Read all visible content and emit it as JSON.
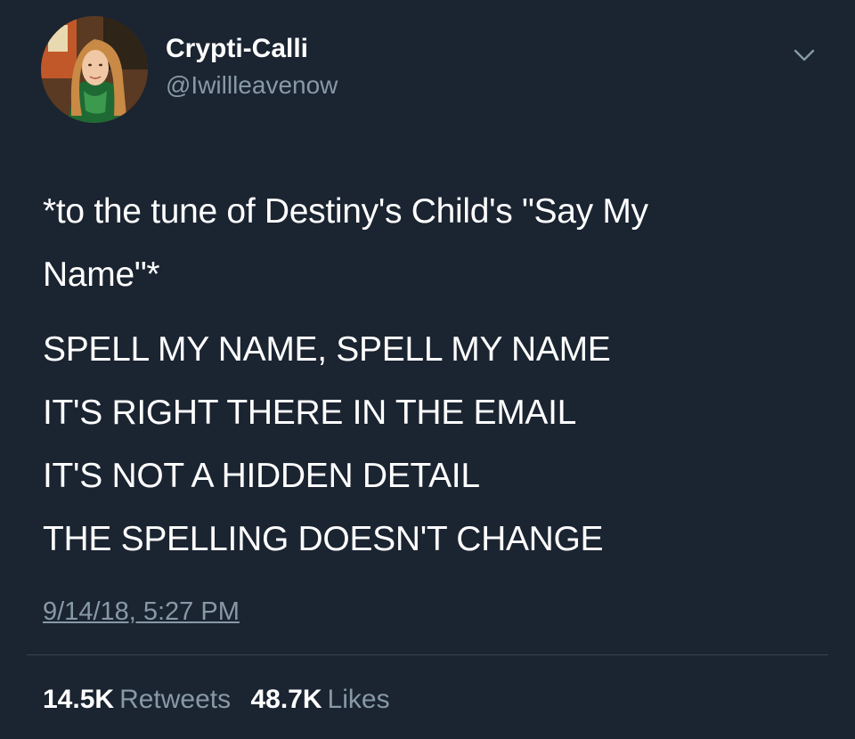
{
  "tweet": {
    "author": {
      "display_name": "Crypti-Calli",
      "handle": "@Iwillleavenow"
    },
    "lines_intro": [
      "*to the tune of Destiny's Child's \"Say My",
      "Name\"*"
    ],
    "lines_song": [
      "SPELL MY NAME, SPELL MY NAME",
      "IT'S RIGHT THERE IN THE EMAIL",
      "IT'S NOT A HIDDEN DETAIL",
      "THE SPELLING DOESN'T CHANGE"
    ],
    "timestamp": "9/14/18, 5:27 PM",
    "stats": {
      "retweets_count": "14.5K",
      "retweets_label": "Retweets",
      "likes_count": "48.7K",
      "likes_label": "Likes"
    }
  },
  "colors": {
    "background": "#1b2431",
    "text_primary": "#ffffff",
    "text_secondary": "#8899a6",
    "divider": "#38444d"
  },
  "icons": {
    "menu": "chevron-down-icon",
    "avatar": "avatar"
  }
}
